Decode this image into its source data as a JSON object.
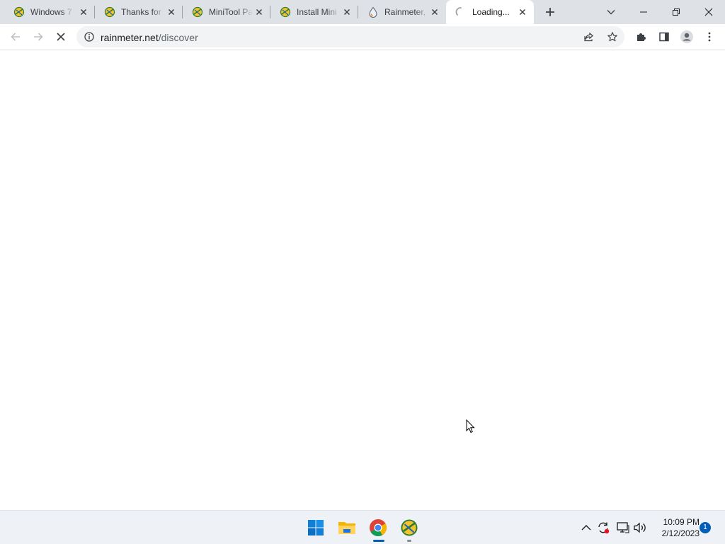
{
  "browser": {
    "tabs": [
      {
        "title": "Windows 7",
        "favicon": "minitool-icon"
      },
      {
        "title": "Thanks for",
        "favicon": "minitool-icon"
      },
      {
        "title": "MiniTool Pa",
        "favicon": "minitool-icon"
      },
      {
        "title": "Install Mini",
        "favicon": "minitool-icon"
      },
      {
        "title": "Rainmeter,",
        "favicon": "rainmeter-drop-icon"
      },
      {
        "title": "Loading...",
        "favicon": "loading-spinner-icon",
        "active": true
      }
    ],
    "address": {
      "host": "rainmeter.net",
      "path": "/discover"
    }
  },
  "taskbar": {
    "apps": [
      "windows-start-icon",
      "file-explorer-icon",
      "chrome-icon",
      "minitool-icon"
    ],
    "clock": {
      "time": "10:09 PM",
      "date": "2/12/2023"
    },
    "notification_count": "1"
  },
  "colors": {
    "tabstrip": "#dee1e6",
    "omnibox": "#f1f3f4",
    "taskbar": "#eef1f6",
    "accent": "#005fb8"
  }
}
